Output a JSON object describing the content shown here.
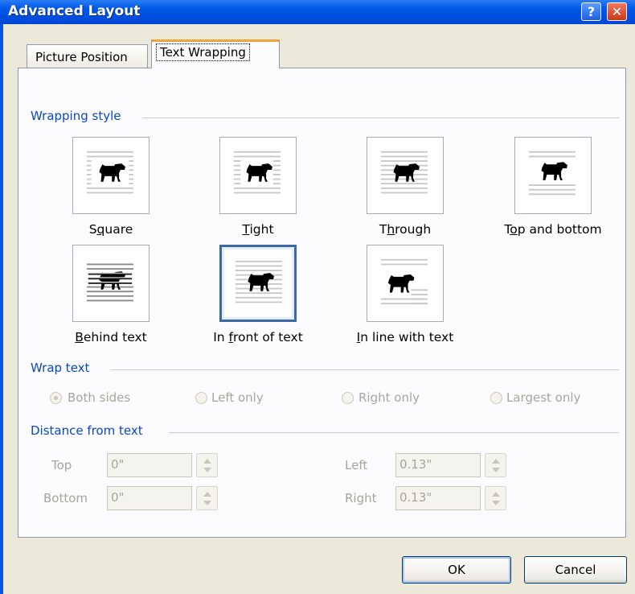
{
  "window": {
    "title": "Advanced Layout",
    "help_glyph": "?",
    "close_glyph": "✕"
  },
  "tabs": [
    {
      "label": "Picture Position",
      "active": false
    },
    {
      "label": "Text Wrapping",
      "active": true
    }
  ],
  "wrapping_style": {
    "heading": "Wrapping style",
    "options": [
      {
        "label_pre": "S",
        "label_ul": "q",
        "label_post": "uare",
        "selected": false
      },
      {
        "label_pre": "",
        "label_ul": "T",
        "label_post": "ight",
        "selected": false
      },
      {
        "label_pre": "T",
        "label_ul": "h",
        "label_post": "rough",
        "selected": false
      },
      {
        "label_pre": "T",
        "label_ul": "o",
        "label_post": "p and bottom",
        "selected": false
      },
      {
        "label_pre": "",
        "label_ul": "B",
        "label_post": "ehind text",
        "selected": false
      },
      {
        "label_pre": "In ",
        "label_ul": "f",
        "label_post": "ront of text",
        "selected": true
      },
      {
        "label_pre": "",
        "label_ul": "I",
        "label_post": "n line with text",
        "selected": false
      }
    ]
  },
  "wrap_text": {
    "heading": "Wrap text",
    "options": [
      {
        "label": "Both sides",
        "checked": true
      },
      {
        "label": "Left only",
        "checked": false
      },
      {
        "label": "Right only",
        "checked": false
      },
      {
        "label": "Largest only",
        "checked": false
      }
    ]
  },
  "distance": {
    "heading": "Distance from text",
    "top_label": "Top",
    "top_value": "0\"",
    "bottom_label": "Bottom",
    "bottom_value": "0\"",
    "left_label": "Left",
    "left_value": "0.13\"",
    "right_label": "Right",
    "right_value": "0.13\""
  },
  "buttons": {
    "ok": "OK",
    "cancel": "Cancel"
  }
}
